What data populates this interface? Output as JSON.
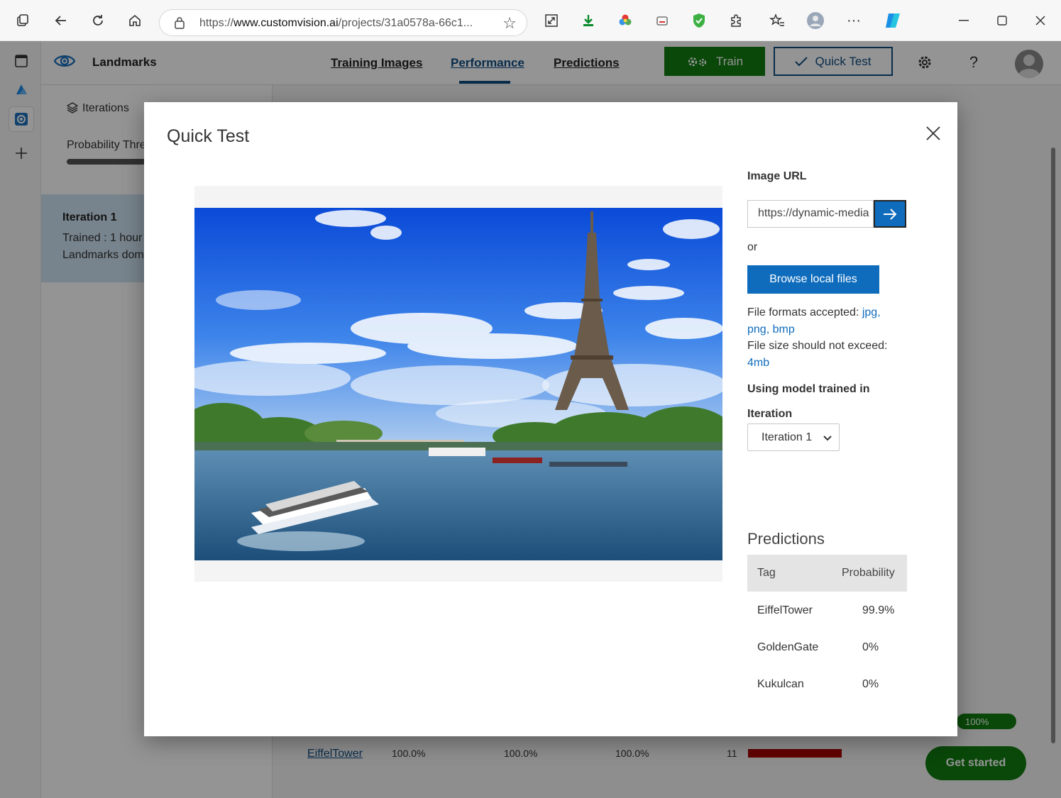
{
  "browser": {
    "url_prefix": "https://",
    "url_host": "www.customvision.ai",
    "url_rest": "/projects/31a0578a-66c1..."
  },
  "app": {
    "project_name": "Landmarks",
    "nav": {
      "training_images": "Training Images",
      "performance": "Performance",
      "predictions": "Predictions"
    },
    "train_label": "Train",
    "quick_test_label": "Quick Test",
    "help_label": "?",
    "left_panel": {
      "iterations_label": "Iterations",
      "probability_label": "Probability Thre",
      "iteration_title": "Iteration 1",
      "iteration_trained": "Trained : 1 hour",
      "iteration_domain": "Landmarks dom"
    },
    "background_row": {
      "tag": "EiffelTower",
      "precision": "100.0%",
      "recall": "100.0%",
      "ap": "100.0%",
      "count": "11"
    },
    "green_badge": "100%",
    "get_started": "Get started"
  },
  "modal": {
    "title": "Quick Test",
    "image_url_label": "Image URL",
    "image_url_value": "https://dynamic-media",
    "or_label": "or",
    "browse_label": "Browse local files",
    "formats_prefix": "File formats accepted: ",
    "formats_jpg": "jpg,",
    "formats_png": "png,",
    "formats_bmp": "bmp",
    "size_prefix": "File size should not exceed:",
    "size_value": "4mb",
    "model_label": "Using model trained in",
    "iteration_label": "Iteration",
    "iteration_selected": "Iteration 1",
    "predictions_title": "Predictions",
    "table_headers": {
      "tag": "Tag",
      "probability": "Probability"
    },
    "predictions": [
      {
        "tag": "EiffelTower",
        "probability": "99.9%"
      },
      {
        "tag": "GoldenGate",
        "probability": "0%"
      },
      {
        "tag": "Kukulcan",
        "probability": "0%"
      }
    ]
  },
  "colors": {
    "accent": "#0f6cbd",
    "train_green": "#107c10",
    "nav_blue": "#0f4c81",
    "bar_red": "#a80000"
  }
}
